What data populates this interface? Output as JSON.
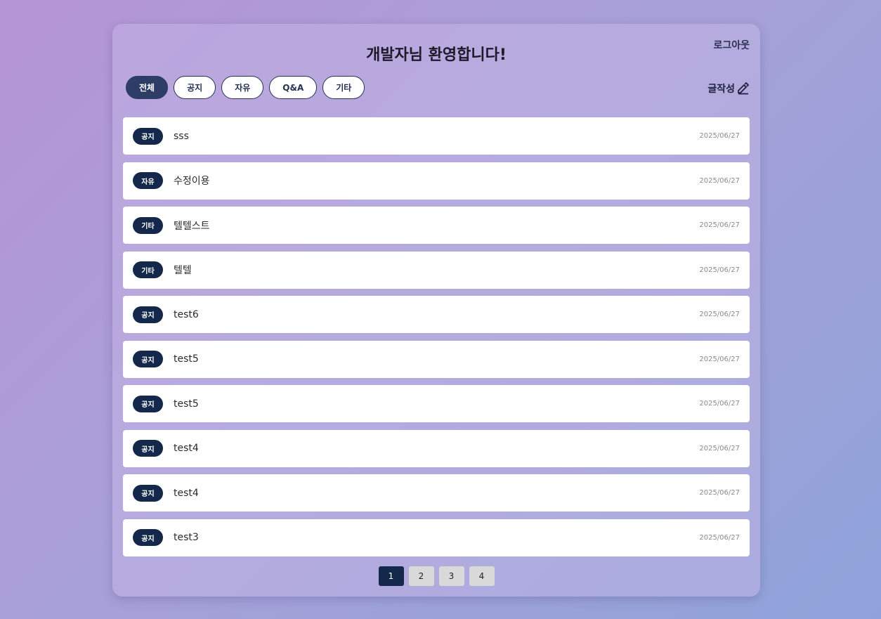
{
  "header": {
    "title": "개발자님 환영합니다!",
    "logout_label": "로그아웃",
    "write_label": "글작성",
    "write_icon": "edit-icon"
  },
  "tabs": [
    {
      "label": "전체",
      "active": true
    },
    {
      "label": "공지",
      "active": false
    },
    {
      "label": "자유",
      "active": false
    },
    {
      "label": "Q&A",
      "active": false
    },
    {
      "label": "기타",
      "active": false
    }
  ],
  "posts": [
    {
      "category": "공지",
      "title": "sss",
      "date": "2025/06/27"
    },
    {
      "category": "자유",
      "title": "수정이용",
      "date": "2025/06/27"
    },
    {
      "category": "기타",
      "title": "텔텔스트",
      "date": "2025/06/27"
    },
    {
      "category": "기타",
      "title": "텔텔",
      "date": "2025/06/27"
    },
    {
      "category": "공지",
      "title": "test6",
      "date": "2025/06/27"
    },
    {
      "category": "공지",
      "title": "test5",
      "date": "2025/06/27"
    },
    {
      "category": "공지",
      "title": "test5",
      "date": "2025/06/27"
    },
    {
      "category": "공지",
      "title": "test4",
      "date": "2025/06/27"
    },
    {
      "category": "공지",
      "title": "test4",
      "date": "2025/06/27"
    },
    {
      "category": "공지",
      "title": "test3",
      "date": "2025/06/27"
    }
  ],
  "pagination": {
    "pages": [
      "1",
      "2",
      "3",
      "4"
    ],
    "current": "1"
  },
  "colors": {
    "accent": "#13284a",
    "active_tab": "#2e3d66"
  }
}
